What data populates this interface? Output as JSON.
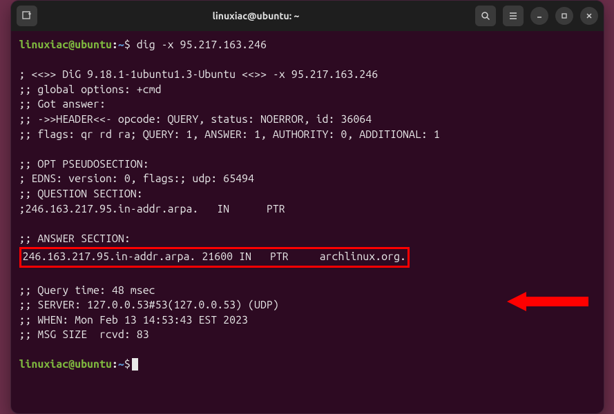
{
  "titlebar": {
    "title": "linuxiac@ubuntu: ~",
    "new_tab_icon": "new-tab-icon",
    "search_icon": "search-icon",
    "menu_icon": "hamburger-icon",
    "minimize_icon": "minimize-icon",
    "maximize_icon": "maximize-icon",
    "close_icon": "close-icon"
  },
  "prompt": {
    "user_host": "linuxiac@ubuntu",
    "path": "~",
    "symbol": "$"
  },
  "command": "dig -x 95.217.163.246",
  "output": {
    "l1": "",
    "l2": "; <<>> DiG 9.18.1-1ubuntu1.3-Ubuntu <<>> -x 95.217.163.246",
    "l3": ";; global options: +cmd",
    "l4": ";; Got answer:",
    "l5": ";; ->>HEADER<<- opcode: QUERY, status: NOERROR, id: 36064",
    "l6": ";; flags: qr rd ra; QUERY: 1, ANSWER: 1, AUTHORITY: 0, ADDITIONAL: 1",
    "l7": "",
    "l8": ";; OPT PSEUDOSECTION:",
    "l9": "; EDNS: version: 0, flags:; udp: 65494",
    "l10": ";; QUESTION SECTION:",
    "l11": ";246.163.217.95.in-addr.arpa.   IN      PTR",
    "l12": "",
    "l13": ";; ANSWER SECTION:",
    "answer_line": "246.163.217.95.in-addr.arpa. 21600 IN   PTR     archlinux.org.",
    "l15": "",
    "l16": ";; Query time: 48 msec",
    "l17": ";; SERVER: 127.0.0.53#53(127.0.0.53) (UDP)",
    "l18": ";; WHEN: Mon Feb 13 14:53:43 EST 2023",
    "l19": ";; MSG SIZE  rcvd: 83",
    "l20": ""
  }
}
